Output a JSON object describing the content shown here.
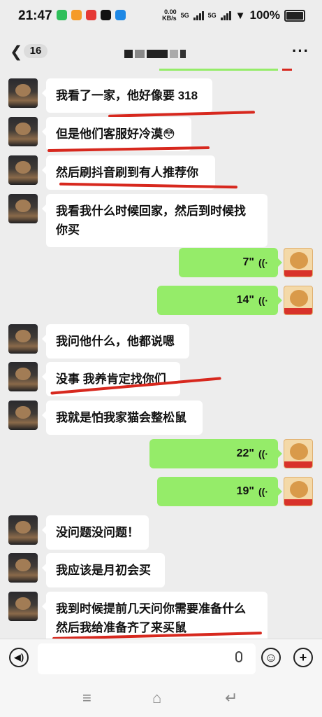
{
  "status": {
    "time": "21:47",
    "net_speed_top": "0.00",
    "net_speed_unit": "KB/s",
    "sig1": "5G",
    "sig2": "5G",
    "battery": "100%"
  },
  "header": {
    "back_count": "16",
    "more_label": "···"
  },
  "messages": [
    {
      "side": "left",
      "type": "text",
      "lines": [
        "我看了一家，他好像要 318"
      ]
    },
    {
      "side": "left",
      "type": "text",
      "lines": [
        "但是他们客服好冷漠😳"
      ]
    },
    {
      "side": "left",
      "type": "text",
      "lines": [
        "然后刷抖音刷到有人推荐你"
      ]
    },
    {
      "side": "left",
      "type": "text",
      "lines": [
        "我看我什么时候回家，然后到时候找",
        "你买"
      ]
    },
    {
      "side": "right",
      "type": "voice",
      "duration": "7\""
    },
    {
      "side": "right",
      "type": "voice",
      "duration": "14\""
    },
    {
      "side": "left",
      "type": "text",
      "lines": [
        "我问他什么，他都说嗯"
      ]
    },
    {
      "side": "left",
      "type": "text",
      "lines": [
        "没事 我养肯定找你们"
      ]
    },
    {
      "side": "left",
      "type": "text",
      "lines": [
        "我就是怕我家猫会整松鼠"
      ]
    },
    {
      "side": "right",
      "type": "voice",
      "duration": "22\""
    },
    {
      "side": "right",
      "type": "voice",
      "duration": "19\""
    },
    {
      "side": "left",
      "type": "text",
      "lines": [
        "没问题没问题！"
      ]
    },
    {
      "side": "left",
      "type": "text",
      "lines": [
        "我应该是月初会买"
      ]
    },
    {
      "side": "left",
      "type": "text",
      "lines": [
        "我到时候提前几天问你需要准备什么",
        "然后我给准备齐了来买鼠"
      ]
    }
  ],
  "input": {
    "placeholder": ""
  },
  "icons": {
    "voice_toggle": "voice-mode-icon",
    "mic": "mic-icon",
    "emoji": "emoji-icon",
    "plus": "plus-icon"
  },
  "colors": {
    "sent_bubble": "#95ec69",
    "received_bubble": "#ffffff",
    "annotation": "#d7281e"
  }
}
